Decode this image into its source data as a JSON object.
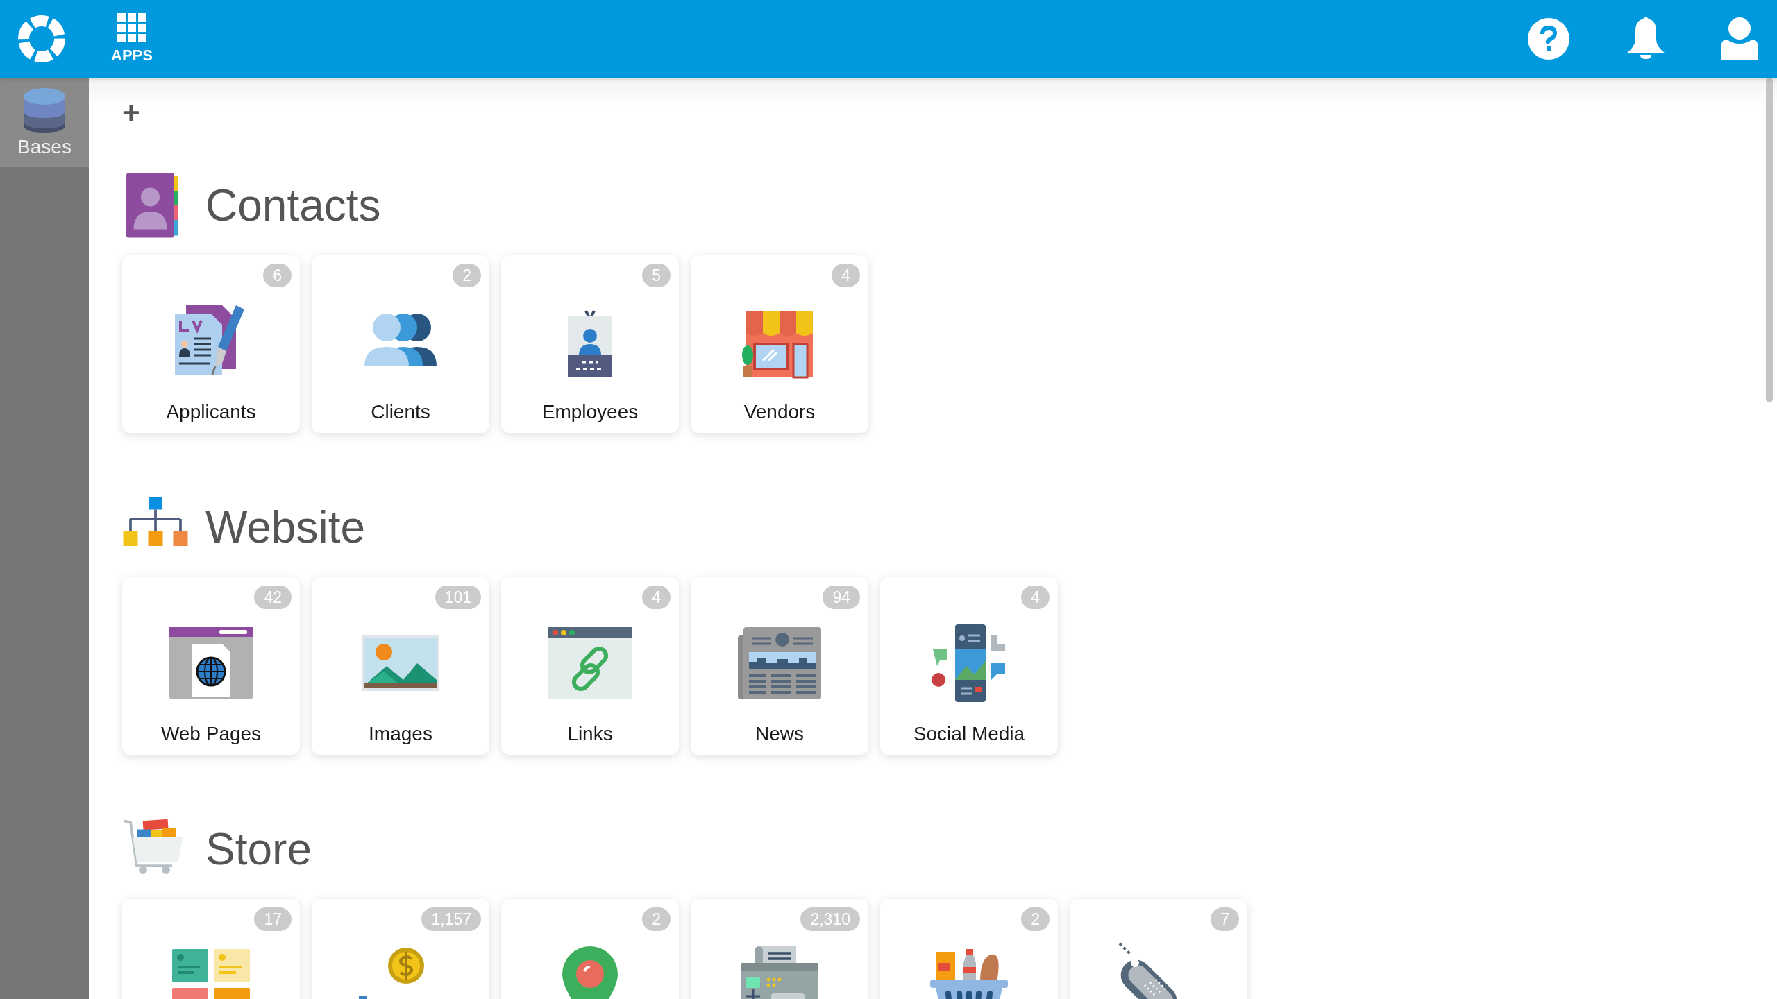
{
  "topbar": {
    "apps_label": "APPS"
  },
  "sidebar": {
    "items": [
      {
        "label": "Bases",
        "selected": true
      }
    ]
  },
  "add_button": "+",
  "sections": [
    {
      "title": "Contacts",
      "cards": [
        {
          "label": "Applicants",
          "count": "6"
        },
        {
          "label": "Clients",
          "count": "2"
        },
        {
          "label": "Employees",
          "count": "5"
        },
        {
          "label": "Vendors",
          "count": "4"
        }
      ]
    },
    {
      "title": "Website",
      "cards": [
        {
          "label": "Web Pages",
          "count": "42"
        },
        {
          "label": "Images",
          "count": "101"
        },
        {
          "label": "Links",
          "count": "4"
        },
        {
          "label": "News",
          "count": "94"
        },
        {
          "label": "Social Media",
          "count": "4"
        }
      ]
    },
    {
      "title": "Store",
      "cards": [
        {
          "count": "17"
        },
        {
          "count": "1,157"
        },
        {
          "count": "2"
        },
        {
          "count": "2,310"
        },
        {
          "count": "2"
        },
        {
          "count": "7"
        }
      ]
    }
  ]
}
